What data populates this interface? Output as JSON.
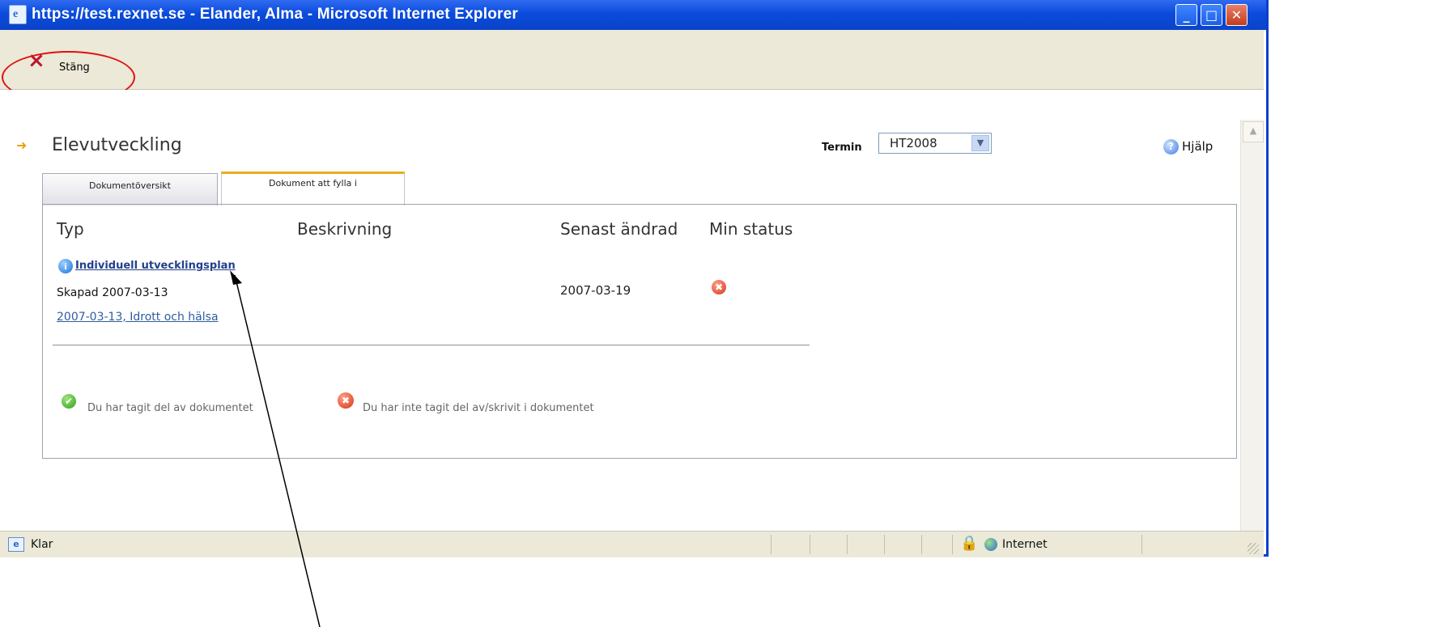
{
  "window": {
    "title": "https://test.rexnet.se - Elander, Alma - Microsoft Internet Explorer",
    "controls": {
      "minimize": "_",
      "maximize": "□",
      "close": "✕"
    }
  },
  "toolbar": {
    "close_label": "Stäng"
  },
  "page": {
    "title": "Elevutveckling",
    "term_label": "Termin",
    "term_value": "HT2008",
    "help_label": "Hjälp"
  },
  "tabs": [
    {
      "label": "Dokumentöversikt"
    },
    {
      "label": "Dokument att fylla i"
    }
  ],
  "table": {
    "headers": [
      "Typ",
      "Beskrivning",
      "Senast ändrad",
      "Min status"
    ],
    "rows": [
      {
        "title": "Individuell utvecklingsplan",
        "created": "Skapad 2007-03-13",
        "entry": "2007-03-13, Idrott och hälsa",
        "changed": "2007-03-19",
        "status": "✖"
      }
    ]
  },
  "legend": {
    "done_icon": "✔",
    "done_label": "Du har tagit del av dokumentet",
    "not_done_icon": "✖",
    "not_done_label": "Du har inte tagit del av/skrivit i dokumentet"
  },
  "statusbar": {
    "status": "Klar",
    "zone": "Internet"
  },
  "colors": {
    "title_bar": "#0b4bdc",
    "accent_tab": "#f1a91b",
    "annotation_oval": "#e01010"
  }
}
